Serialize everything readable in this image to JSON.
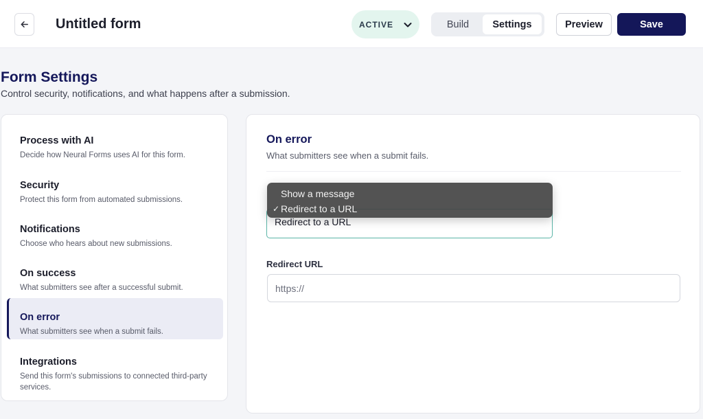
{
  "header": {
    "title": "Untitled form",
    "status": "ACTIVE",
    "tabs": [
      {
        "label": "Build",
        "selected": false
      },
      {
        "label": "Settings",
        "selected": true
      }
    ],
    "preview_label": "Preview",
    "save_label": "Save"
  },
  "page": {
    "title": "Form Settings",
    "subtitle": "Control security, notifications, and what happens after a submission."
  },
  "sidebar": {
    "items": [
      {
        "title": "Process with AI",
        "description": "Decide how Neural Forms uses AI for this form."
      },
      {
        "title": "Security",
        "description": "Protect this form from automated submissions."
      },
      {
        "title": "Notifications",
        "description": "Choose who hears about new submissions."
      },
      {
        "title": "On success",
        "description": "What submitters see after a successful submit."
      },
      {
        "title": "On error",
        "description": "What submitters see when a submit fails."
      },
      {
        "title": "Integrations",
        "description": "Send this form's submissions to connected third-party services."
      }
    ],
    "active_index": 4
  },
  "main": {
    "section_title": "On error",
    "section_description": "What submitters see when a submit fails.",
    "action_select": {
      "value": "Redirect to a URL",
      "options": [
        {
          "label": "Show a message",
          "checked": false
        },
        {
          "label": "Redirect to a URL",
          "checked": true
        }
      ],
      "check_glyph": "✓"
    },
    "redirect_url": {
      "label": "Redirect URL",
      "placeholder": "https://",
      "value": ""
    }
  },
  "colors": {
    "brand_navy": "#14175a",
    "status_bg": "#e3f5ee",
    "focus_teal": "#5ab4a7"
  },
  "icons": {
    "back": "arrow-left-icon",
    "status_chevron": "chevron-down-icon",
    "check": "check-icon"
  }
}
